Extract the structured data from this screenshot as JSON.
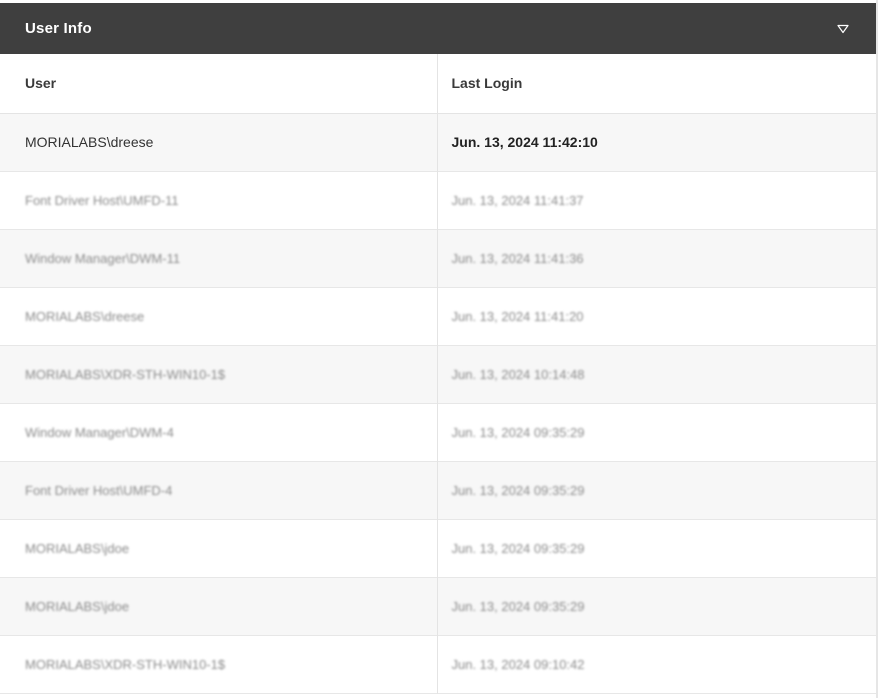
{
  "panel": {
    "title": "User Info",
    "collapse_icon": "triangle-down-icon"
  },
  "table": {
    "columns": [
      "User",
      "Last Login"
    ],
    "rows": [
      {
        "user": "MORIALABS\\dreese",
        "last_login": "Jun. 13, 2024 11:42:10"
      },
      {
        "user": "Font Driver Host\\UMFD-11",
        "last_login": "Jun. 13, 2024 11:41:37"
      },
      {
        "user": "Window Manager\\DWM-11",
        "last_login": "Jun. 13, 2024 11:41:36"
      },
      {
        "user": "MORIALABS\\dreese",
        "last_login": "Jun. 13, 2024 11:41:20"
      },
      {
        "user": "MORIALABS\\XDR-STH-WIN10-1$",
        "last_login": "Jun. 13, 2024 10:14:48"
      },
      {
        "user": "Window Manager\\DWM-4",
        "last_login": "Jun. 13, 2024 09:35:29"
      },
      {
        "user": "Font Driver Host\\UMFD-4",
        "last_login": "Jun. 13, 2024 09:35:29"
      },
      {
        "user": "MORIALABS\\jdoe",
        "last_login": "Jun. 13, 2024 09:35:29"
      },
      {
        "user": "MORIALABS\\jdoe",
        "last_login": "Jun. 13, 2024 09:35:29"
      },
      {
        "user": "MORIALABS\\XDR-STH-WIN10-1$",
        "last_login": "Jun. 13, 2024 09:10:42"
      }
    ]
  },
  "colors": {
    "header_bg": "#3f3f3f",
    "row_alt_bg": "#f7f7f7"
  }
}
